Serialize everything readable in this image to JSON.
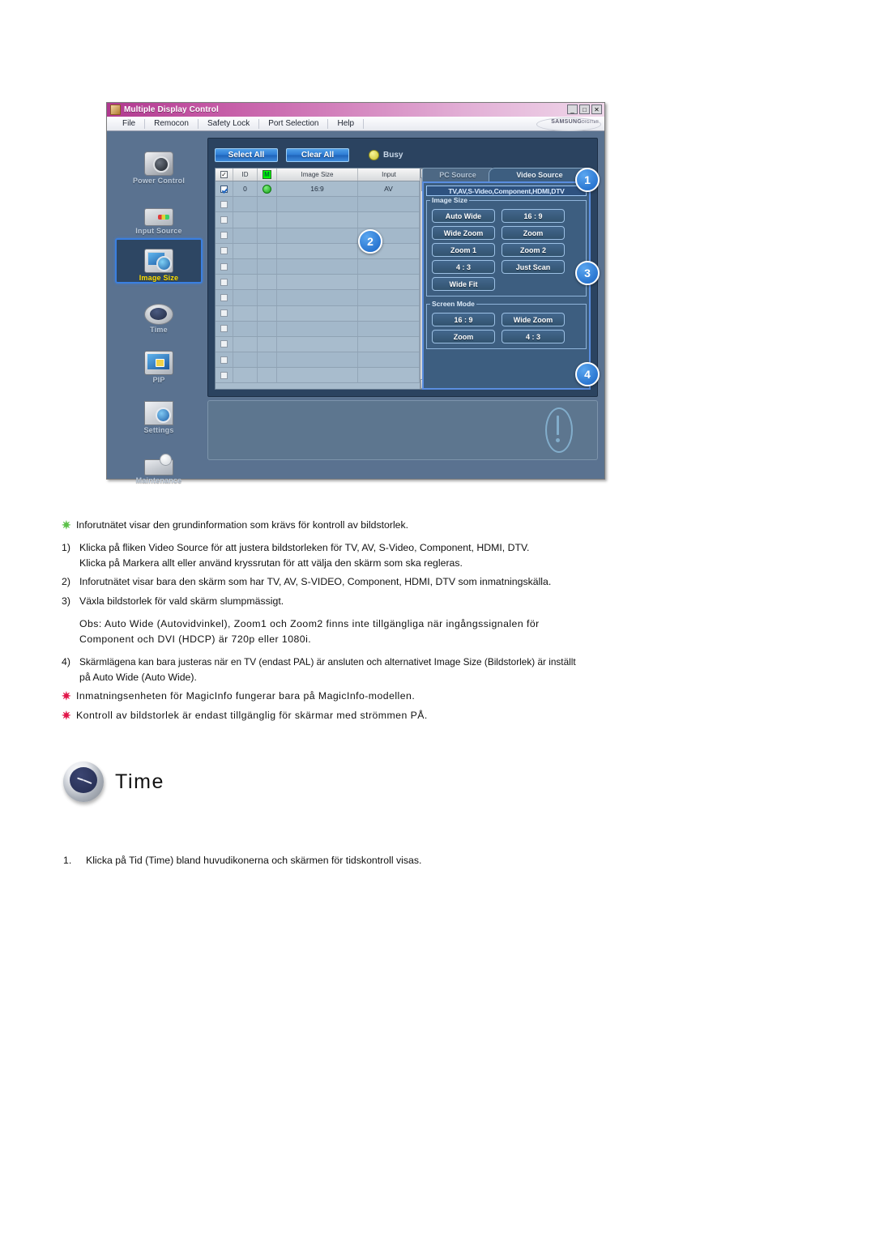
{
  "app": {
    "title": "Multiple Display Control",
    "window_buttons": [
      "_",
      "□",
      "✕"
    ],
    "menu": [
      "File",
      "Remocon",
      "Safety Lock",
      "Port Selection",
      "Help"
    ],
    "brand": "SAMSUNG",
    "brand_sub": "DIGITall",
    "sidebar": [
      {
        "label": "Power Control",
        "icon": "power-control-icon",
        "selected": false
      },
      {
        "label": "Input Source",
        "icon": "input-source-icon",
        "selected": false
      },
      {
        "label": "Image Size",
        "icon": "image-size-icon",
        "selected": true
      },
      {
        "label": "Time",
        "icon": "time-icon",
        "selected": false
      },
      {
        "label": "PIP",
        "icon": "pip-icon",
        "selected": false
      },
      {
        "label": "Settings",
        "icon": "settings-icon",
        "selected": false
      },
      {
        "label": "Maintenance",
        "icon": "maintenance-icon",
        "selected": false
      }
    ],
    "toolbar": {
      "select_all": "Select All",
      "clear_all": "Clear All",
      "status_label": "Busy"
    },
    "table": {
      "headers": [
        "",
        "ID",
        "M",
        "Image Size",
        "Input"
      ],
      "rows": [
        {
          "checked": true,
          "id": "0",
          "power": "on",
          "image_size": "16:9",
          "input": "AV"
        },
        {
          "checked": false,
          "id": "",
          "power": "",
          "image_size": "",
          "input": ""
        },
        {
          "checked": false,
          "id": "",
          "power": "",
          "image_size": "",
          "input": ""
        },
        {
          "checked": false,
          "id": "",
          "power": "",
          "image_size": "",
          "input": ""
        },
        {
          "checked": false,
          "id": "",
          "power": "",
          "image_size": "",
          "input": ""
        },
        {
          "checked": false,
          "id": "",
          "power": "",
          "image_size": "",
          "input": ""
        },
        {
          "checked": false,
          "id": "",
          "power": "",
          "image_size": "",
          "input": ""
        },
        {
          "checked": false,
          "id": "",
          "power": "",
          "image_size": "",
          "input": ""
        },
        {
          "checked": false,
          "id": "",
          "power": "",
          "image_size": "",
          "input": ""
        },
        {
          "checked": false,
          "id": "",
          "power": "",
          "image_size": "",
          "input": ""
        },
        {
          "checked": false,
          "id": "",
          "power": "",
          "image_size": "",
          "input": ""
        },
        {
          "checked": false,
          "id": "",
          "power": "",
          "image_size": "",
          "input": ""
        },
        {
          "checked": false,
          "id": "",
          "power": "",
          "image_size": "",
          "input": ""
        }
      ],
      "scroll_up": "▲",
      "scroll_down": "▼"
    },
    "source_panel": {
      "tab_pc": "PC Source",
      "tab_video": "Video Source",
      "source_title": "TV,AV,S-Video,Component,HDMI,DTV",
      "image_size_group": "Image Size",
      "image_size_buttons": [
        "Auto Wide",
        "16 : 9",
        "Wide Zoom",
        "Zoom",
        "Zoom 1",
        "Zoom 2",
        "4 : 3",
        "Just Scan",
        "Wide Fit"
      ],
      "screen_mode_group": "Screen Mode",
      "screen_mode_buttons": [
        "16 : 9",
        "Wide Zoom",
        "Zoom",
        "4 : 3"
      ]
    },
    "callouts": [
      "1",
      "2",
      "3",
      "4"
    ]
  },
  "doc": {
    "note1": "Inforutnätet visar den grundinformation som krävs för kontroll av bildstorlek.",
    "item1_num": "1)",
    "item1_a": "Klicka på fliken Video Source för att justera bildstorleken för TV, AV, S-Video, Component, HDMI, DTV.",
    "item1_b": "Klicka på Markera allt eller använd kryssrutan för att välja den skärm som ska regleras.",
    "item2_num": "2)",
    "item2": "Inforutnätet visar bara den skärm som har TV, AV, S-VIDEO, Component, HDMI, DTV som inmatningskälla.",
    "item3_num": "3)",
    "item3": "Växla bildstorlek för vald skärm slumpmässigt.",
    "obs_a": "Obs: Auto Wide (Autovidvinkel), Zoom1 och Zoom2 finns inte tillgängliga när ingångssignalen för",
    "obs_b": "Component och DVI (HDCP) är 720p eller 1080i.",
    "item4_num": "4)",
    "item4_a": "Skärmlägena kan bara justeras när en TV (endast PAL) är ansluten och alternativet Image Size (Bildstorlek) är inställt",
    "item4_b": "på Auto Wide (Auto Wide).",
    "note2": "Inmatningsenheten för MagicInfo fungerar bara på MagicInfo-modellen.",
    "note3": "Kontroll av bildstorlek är endast tillgänglig för skärmar med strömmen PÅ."
  },
  "time_section": {
    "title": "Time",
    "step_num": "1.",
    "step_text": "Klicka på Tid (Time) bland huvudikonerna och skärmen för tidskontroll visas."
  },
  "colors": {
    "accent_blue": "#1763c4",
    "app_bg": "#5a7290",
    "panel_bg": "#2b4360",
    "title_pink": "#c254a2",
    "highlight_yellow": "#ffe000",
    "star_green": "#5cc14a",
    "star_red": "#e2174a"
  }
}
